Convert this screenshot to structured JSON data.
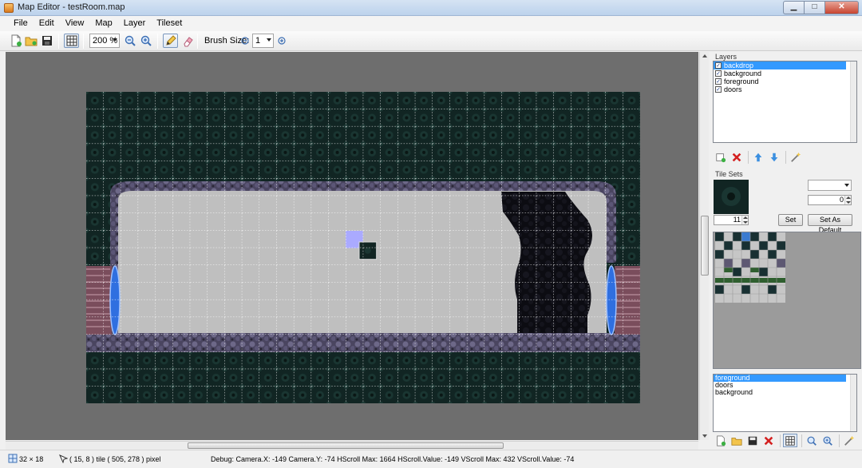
{
  "window": {
    "title": "Map Editor  -  testRoom.map"
  },
  "menu": [
    "File",
    "Edit",
    "View",
    "Map",
    "Layer",
    "Tileset"
  ],
  "toolbar": {
    "zoom_value": "200 %",
    "brush_label": "Brush Size:",
    "brush_size": "1",
    "icons": [
      "new-file-icon",
      "open-folder-icon",
      "save-icon",
      "grid-icon",
      "zoom-out-icon",
      "zoom-in-icon",
      "pencil-icon",
      "eraser-icon",
      "brush-minus-icon",
      "brush-plus-icon"
    ]
  },
  "layers": {
    "label": "Layers",
    "items": [
      {
        "name": "backdrop",
        "checked": true,
        "selected": true
      },
      {
        "name": "background",
        "checked": true,
        "selected": false
      },
      {
        "name": "foreground",
        "checked": true,
        "selected": false
      },
      {
        "name": "doors",
        "checked": true,
        "selected": false
      }
    ]
  },
  "tilesets": {
    "label": "Tile Sets",
    "tile_index": "11",
    "select_value": "",
    "offset_value": "0",
    "set_button": "Set",
    "default_button": "Set As Default"
  },
  "layer_order": {
    "items": [
      {
        "name": "foreground",
        "selected": true
      },
      {
        "name": "doors",
        "selected": false
      },
      {
        "name": "background",
        "selected": false
      }
    ]
  },
  "status": {
    "map_size": "32 × 18",
    "cursor": "( 15, 8 )  tile    ( 505, 278 )  pixel",
    "debug": "Debug:  Camera.X:  -149  Camera.Y:  -74  HScroll Max: 1664  HScroll.Value: -149  VScroll Max: 432  VScroll.Value: -74"
  },
  "colors": {
    "workspace_bg": "#6e6e6e",
    "backdrop_tile": "#102422",
    "room_floor": "#bfbfbf",
    "rock_rim": "#5d5872",
    "door_blue": "#2f6fe0",
    "door_frame": "#7a4d5c",
    "cave_shadow": "#0c0c12",
    "cursor_highlight": "#aaaaff",
    "selection_blue": "#3399ff"
  }
}
